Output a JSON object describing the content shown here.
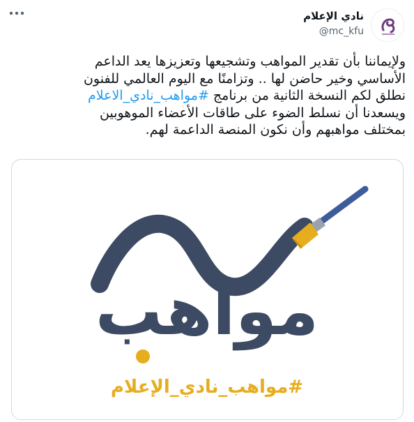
{
  "account": {
    "name": "نادي الإعلام",
    "handle": "@mc_kfu"
  },
  "tweet": {
    "lines": [
      "ولإيماننا بأن تقدير المواهب وتشجيعها وتعزيزها يعد الداعم",
      "الأساسي وخير حاضن لها .. وتزامنًا مع اليوم العالمي للفنون",
      "نطلق لكم النسخة الثانية من برنامج",
      "ويسعدنا أن نسلط الضوء على طاقات الأعضاء الموهوبين",
      "بمختلف مواهبهم وأن نكون المنصة الداعمة لهم."
    ],
    "hashtag": "#مواهب_نادي_الاعلام"
  },
  "media": {
    "logo_word": "مواهب",
    "logo_hashtag": "#مواهب_نادي_الإعلام"
  },
  "colors": {
    "hashtag_blue": "#1d9bf0",
    "logo_navy": "#3d4a63",
    "logo_gold": "#e6ad1e",
    "brush_blue": "#3e5b9a",
    "avatar_purple": "#6e3a7e"
  },
  "icons": {
    "more": "more-horizontal-icon",
    "avatar": "media-club-logo-icon",
    "brush": "paintbrush-icon"
  }
}
